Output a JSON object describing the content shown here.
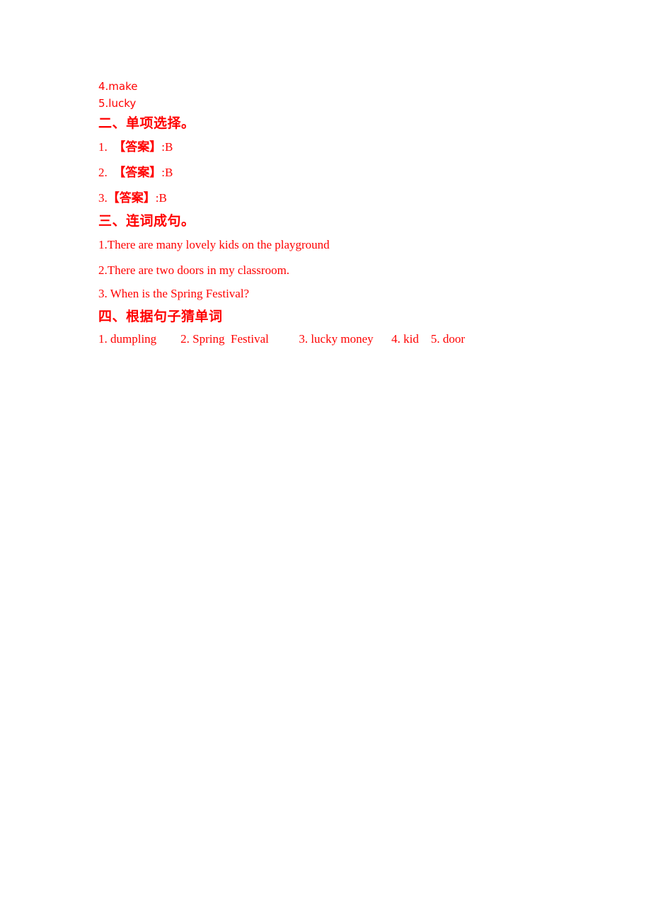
{
  "document": {
    "text_color": "#ff0000",
    "background_color": "#ffffff",
    "vocab_answers": [
      "4.make",
      "5.lucky"
    ],
    "section_two": {
      "heading": "二、单项选择。",
      "answers": [
        {
          "number": "1.",
          "gap": "  ",
          "tag": "【答案】",
          "value": ":B"
        },
        {
          "number": "2.",
          "gap": "  ",
          "tag": "【答案】",
          "value": ":B"
        },
        {
          "number": "3.",
          "gap": "",
          "tag": "【答案】",
          "value": ":B"
        }
      ]
    },
    "section_three": {
      "heading": "三、连词成句。",
      "sentences": [
        "1.There are many lovely kids on the playground",
        "2.There are two doors in my classroom.",
        "3. When is the Spring Festival?"
      ]
    },
    "section_four": {
      "heading": "四、根据句子猜单词",
      "answer_line": "1. dumpling        2. Spring  Festival          3. lucky money      4. kid    5. door"
    }
  }
}
